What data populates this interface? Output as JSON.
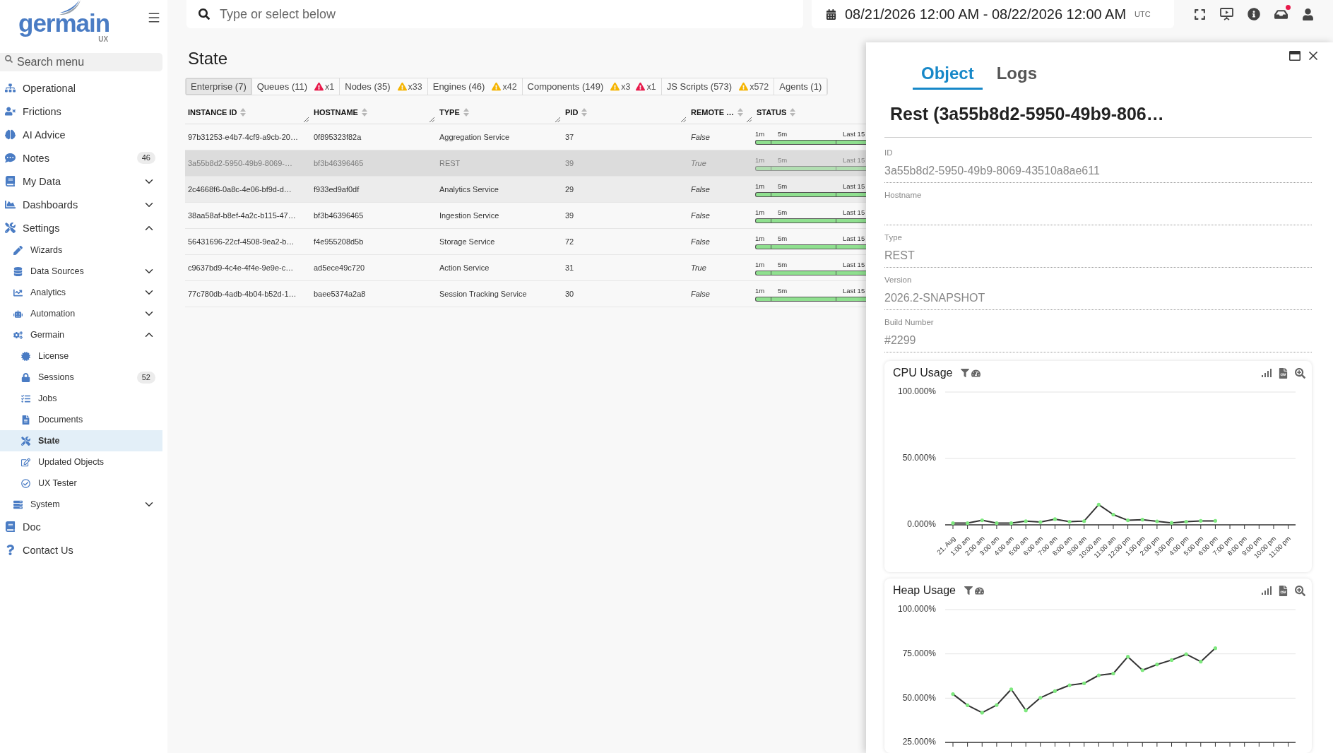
{
  "sidebar": {
    "logo": {
      "text": "germain",
      "sub": "UX"
    },
    "search": {
      "placeholder": "Search menu"
    },
    "items": [
      {
        "label": "Operational",
        "selected": false
      },
      {
        "label": "Frictions",
        "selected": false
      },
      {
        "label": "AI Advice",
        "selected": false
      },
      {
        "label": "Notes",
        "selected": false,
        "badge": "46"
      },
      {
        "label": "My Data",
        "selected": false,
        "expanded": false
      },
      {
        "label": "Dashboards",
        "selected": false,
        "expanded": false
      },
      {
        "label": "Settings",
        "selected": false,
        "expanded": true,
        "children": [
          {
            "label": "Wizards",
            "selected": false
          },
          {
            "label": "Data Sources",
            "selected": false,
            "expanded": false
          },
          {
            "label": "Analytics",
            "selected": false,
            "expanded": false
          },
          {
            "label": "Automation",
            "selected": false,
            "expanded": false
          },
          {
            "label": "Germain",
            "selected": false,
            "expanded": true,
            "children": [
              {
                "label": "License",
                "selected": false
              },
              {
                "label": "Sessions",
                "selected": false,
                "badge": "52"
              },
              {
                "label": "Jobs",
                "selected": false
              },
              {
                "label": "Documents",
                "selected": false
              },
              {
                "label": "State",
                "selected": true
              },
              {
                "label": "Updated Objects",
                "selected": false
              },
              {
                "label": "UX Tester",
                "selected": false
              }
            ]
          },
          {
            "label": "System",
            "selected": false,
            "expanded": false
          }
        ]
      },
      {
        "label": "Doc",
        "selected": false
      },
      {
        "label": "Contact Us",
        "selected": false
      }
    ]
  },
  "topbar": {
    "search": {
      "placeholder": "Type or select below"
    },
    "date_range": {
      "text": "08/21/2026 12:00 AM - 08/22/2026 12:00 AM",
      "timezone": "UTC"
    },
    "messages": {
      "unread": true
    }
  },
  "page": {
    "title": "State",
    "tabs": [
      {
        "label": "Enterprise (7)",
        "selected": true
      },
      {
        "label": "Queues (11)",
        "selected": false,
        "alerts": [
          {
            "kind": "error",
            "count": "x1"
          }
        ]
      },
      {
        "label": "Nodes (35)",
        "selected": false,
        "alerts": [
          {
            "kind": "warning",
            "count": "x33"
          }
        ]
      },
      {
        "label": "Engines (46)",
        "selected": false,
        "alerts": [
          {
            "kind": "warning",
            "count": "x42"
          }
        ]
      },
      {
        "label": "Components (149)",
        "selected": false,
        "alerts": [
          {
            "kind": "warning",
            "count": "x3"
          },
          {
            "kind": "error",
            "count": "x1"
          }
        ]
      },
      {
        "label": "JS Scripts (573)",
        "selected": false,
        "alerts": [
          {
            "kind": "warning",
            "count": "x572"
          }
        ]
      },
      {
        "label": "Agents (1)",
        "selected": false
      }
    ]
  },
  "table": {
    "columns": [
      {
        "label": "INSTANCE ID",
        "kind": "text"
      },
      {
        "label": "HOSTNAME",
        "kind": "text"
      },
      {
        "label": "TYPE",
        "kind": "text"
      },
      {
        "label": "PID",
        "kind": "text"
      },
      {
        "label": "REMOTE …",
        "kind": "flag"
      },
      {
        "label": "STATUS",
        "kind": "status"
      }
    ],
    "rows": [
      {
        "cells": [
          "97b31253-e4b7-4cf9-a9cb-20…",
          "0f895323f82a",
          "Aggregation Service",
          "37",
          "False"
        ],
        "status": [
          {
            "label": "1m",
            "healthy": true
          },
          {
            "label": "5m",
            "healthy": true
          },
          {
            "label": "Last 15",
            "healthy": true
          }
        ],
        "selected": false,
        "hovered": false
      },
      {
        "cells": [
          "3a55b8d2-5950-49b9-8069-…",
          "bf3b46396465",
          "REST",
          "39",
          "True"
        ],
        "status": [
          {
            "label": "1m",
            "healthy": true
          },
          {
            "label": "5m",
            "healthy": true
          },
          {
            "label": "Last 15",
            "healthy": true
          }
        ],
        "selected": true,
        "hovered": false
      },
      {
        "cells": [
          "2c4668f6-0a8c-4e06-bf9d-d…",
          "f933ed9af0df",
          "Analytics Service",
          "29",
          "False"
        ],
        "status": [
          {
            "label": "1m",
            "healthy": true
          },
          {
            "label": "5m",
            "healthy": true
          },
          {
            "label": "Last 15",
            "healthy": true
          }
        ],
        "selected": false,
        "hovered": true
      },
      {
        "cells": [
          "38aa58af-b8ef-4a2c-b115-47…",
          "bf3b46396465",
          "Ingestion Service",
          "39",
          "False"
        ],
        "status": [
          {
            "label": "1m",
            "healthy": true
          },
          {
            "label": "5m",
            "healthy": true
          },
          {
            "label": "Last 15",
            "healthy": true
          }
        ],
        "selected": false,
        "hovered": false
      },
      {
        "cells": [
          "56431696-22cf-4508-9ea2-b…",
          "f4e955208d5b",
          "Storage Service",
          "72",
          "False"
        ],
        "status": [
          {
            "label": "1m",
            "healthy": true
          },
          {
            "label": "5m",
            "healthy": true
          },
          {
            "label": "Last 15",
            "healthy": true
          }
        ],
        "selected": false,
        "hovered": false
      },
      {
        "cells": [
          "c9637bd9-4c4e-4f4e-9e9e-c…",
          "ad5ece49c720",
          "Action Service",
          "31",
          "True"
        ],
        "status": [
          {
            "label": "1m",
            "healthy": true
          },
          {
            "label": "5m",
            "healthy": true
          },
          {
            "label": "Last 15",
            "healthy": true
          }
        ],
        "selected": false,
        "hovered": false
      },
      {
        "cells": [
          "77c780db-4adb-4b04-b52d-1…",
          "baee5374a2a8",
          "Session Tracking Service",
          "30",
          "False"
        ],
        "status": [
          {
            "label": "1m",
            "healthy": true
          },
          {
            "label": "5m",
            "healthy": true
          },
          {
            "label": "Last 15",
            "healthy": true
          }
        ],
        "selected": false,
        "hovered": false
      }
    ]
  },
  "detail_panel": {
    "tabs": [
      {
        "label": "Object",
        "selected": true
      },
      {
        "label": "Logs",
        "selected": false
      }
    ],
    "title": "Rest (3a55b8d2-5950-49b9-806…",
    "fields": [
      {
        "label": "ID",
        "value": "3a55b8d2-5950-49b9-8069-43510a8ae611"
      },
      {
        "label": "Hostname"
      },
      {
        "label": "Type",
        "value": "REST"
      },
      {
        "label": "Version",
        "value": "2026.2-SNAPSHOT"
      },
      {
        "label": "Build Number",
        "value": "#2299"
      }
    ],
    "charts": [
      {
        "chart_data": {
          "type": "line",
          "title": "CPU Usage",
          "categories": [
            "21. Aug",
            "1:00 am",
            "2:00 am",
            "3:00 am",
            "4:00 am",
            "5:00 am",
            "6:00 am",
            "7:00 am",
            "8:00 am",
            "9:00 am",
            "10:00 am",
            "11:00 am",
            "12:00 pm",
            "1:00 pm",
            "2:00 pm",
            "3:00 pm",
            "4:00 pm",
            "5:00 pm",
            "6:00 pm",
            "7:00 pm",
            "8:00 pm",
            "9:00 pm",
            "10:00 pm",
            "11:00 pm"
          ],
          "series": [
            {
              "color": "#333333",
              "values": [
                1.3,
                1.3,
                3.4,
                1.3,
                1.3,
                2.8,
                2.1,
                4.3,
                2.4,
                2.8,
                15.2,
                7.7,
                3.4,
                3.9,
                2.6,
                1.5,
                2.4,
                3.0,
                3.0,
                null,
                null,
                null,
                null,
                null
              ]
            }
          ],
          "ylim": [
            0,
            100
          ],
          "yticks": [
            {
              "value": 0,
              "label": "0.000%"
            },
            {
              "value": 50,
              "label": "50.000%"
            },
            {
              "value": 100,
              "label": "100.000%"
            }
          ]
        }
      },
      {
        "chart_data": {
          "type": "line",
          "title": "Heap Usage",
          "series": [
            {
              "color": "#333333",
              "values": [
                52.3,
                46.0,
                41.8,
                46.1,
                55.0,
                43.1,
                50.2,
                54.0,
                57.3,
                58.4,
                62.9,
                63.9,
                73.4,
                65.8,
                69.0,
                71.5,
                74.8,
                70.6,
                78.2,
                null,
                null,
                null,
                null,
                null
              ]
            }
          ],
          "ylim": [
            25,
            100
          ],
          "yticks": [
            {
              "value": 25,
              "label": "25.000%"
            },
            {
              "value": 50,
              "label": "50.000%"
            },
            {
              "value": 75,
              "label": "75.000%"
            },
            {
              "value": 100,
              "label": "100.000%"
            }
          ]
        }
      }
    ]
  }
}
